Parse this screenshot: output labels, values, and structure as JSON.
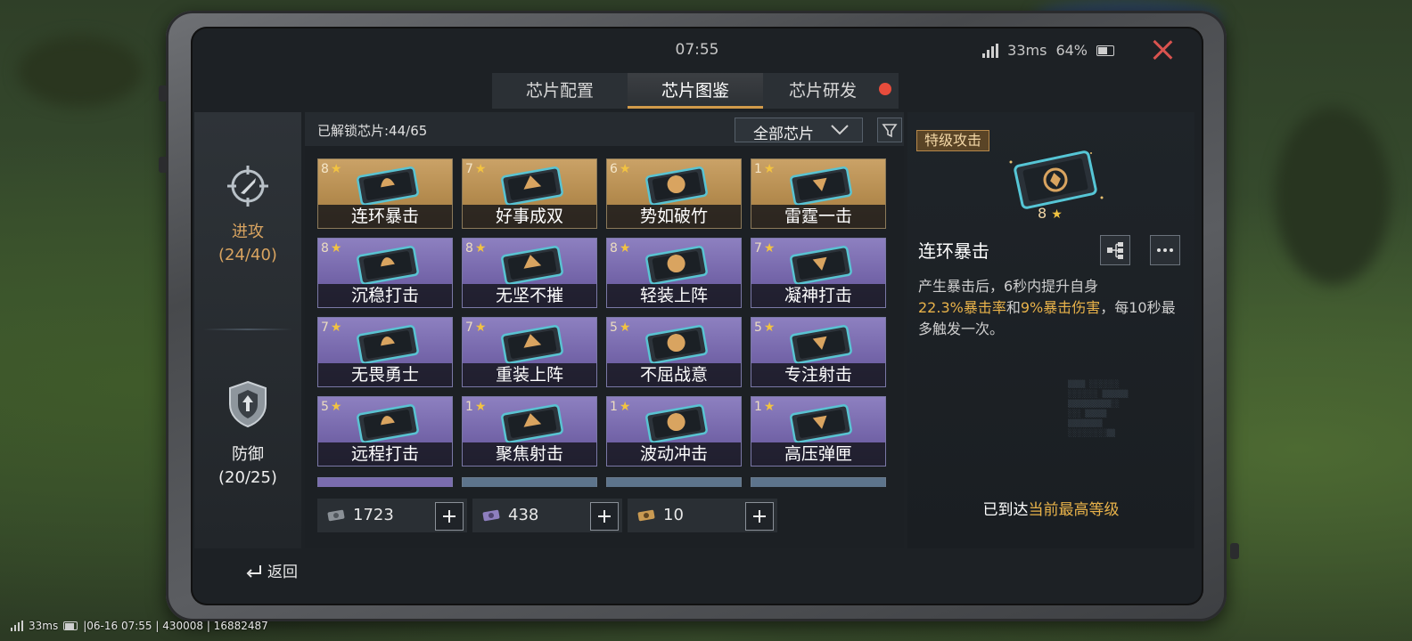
{
  "status": {
    "time": "07:55",
    "ping": "33ms",
    "battery": "64%"
  },
  "tabs": [
    {
      "label": "芯片配置",
      "active": false
    },
    {
      "label": "芯片图鉴",
      "active": true
    },
    {
      "label": "芯片研发",
      "active": false,
      "badge": "red-dot"
    }
  ],
  "nav": {
    "attack": {
      "label": "进攻",
      "count": "(24/40)",
      "icon": "crosshair-bullet-icon"
    },
    "defense": {
      "label": "防御",
      "count": "(20/25)",
      "icon": "shield-arrow-icon"
    }
  },
  "header": {
    "unlocked": "已解锁芯片:44/65",
    "filter_select": "全部芯片"
  },
  "cards": [
    {
      "name": "连环暴击",
      "level": "8",
      "rarity": "gold"
    },
    {
      "name": "好事成双",
      "level": "7",
      "rarity": "gold"
    },
    {
      "name": "势如破竹",
      "level": "6",
      "rarity": "gold"
    },
    {
      "name": "雷霆一击",
      "level": "1",
      "rarity": "gold"
    },
    {
      "name": "沉稳打击",
      "level": "8",
      "rarity": "purple"
    },
    {
      "name": "无坚不摧",
      "level": "8",
      "rarity": "purple"
    },
    {
      "name": "轻装上阵",
      "level": "8",
      "rarity": "purple"
    },
    {
      "name": "凝神打击",
      "level": "7",
      "rarity": "purple"
    },
    {
      "name": "无畏勇士",
      "level": "7",
      "rarity": "purple"
    },
    {
      "name": "重装上阵",
      "level": "7",
      "rarity": "purple"
    },
    {
      "name": "不屈战意",
      "level": "5",
      "rarity": "purple"
    },
    {
      "name": "专注射击",
      "level": "5",
      "rarity": "purple"
    },
    {
      "name": "远程打击",
      "level": "5",
      "rarity": "purple"
    },
    {
      "name": "聚焦射击",
      "level": "1",
      "rarity": "purple"
    },
    {
      "name": "波动冲击",
      "level": "1",
      "rarity": "purple"
    },
    {
      "name": "高压弹匣",
      "level": "1",
      "rarity": "purple"
    }
  ],
  "resources": [
    {
      "value": "1723",
      "icon": "chip-material-gray-icon"
    },
    {
      "value": "438",
      "icon": "chip-material-purple-icon"
    },
    {
      "value": "10",
      "icon": "chip-material-gold-icon"
    }
  ],
  "detail": {
    "category": "特级攻击",
    "level": "8",
    "name": "连环暴击",
    "desc_1": "产生暴击后，6秒内提升自身",
    "desc_hl_1": "22.3%暴击率",
    "desc_mid": "和",
    "desc_hl_2": "9%暴击伤害",
    "desc_2": "，每10秒最多触发一次。",
    "max_prefix": "已到达",
    "max_hl": "当前最高等级"
  },
  "back_label": "返回",
  "footer": {
    "ping": "33ms",
    "info": "|06-16 07:55 | 430008 | 16882487"
  },
  "colors": {
    "gold_accent": "#d19a4a",
    "highlight": "#e8b24a",
    "close_red": "#d9534f",
    "badge_red": "#e74c3c"
  }
}
